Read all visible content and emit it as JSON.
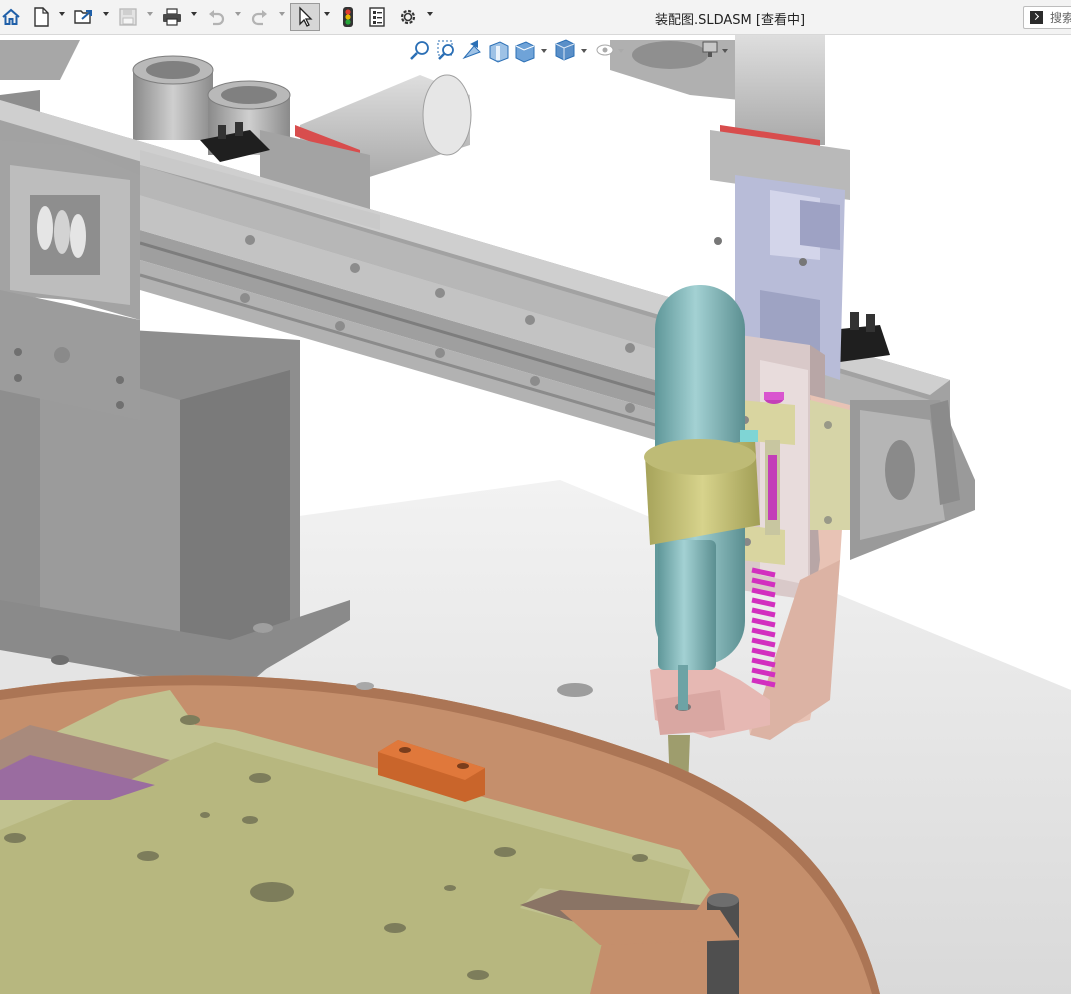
{
  "window": {
    "document_title": "装配图.SLDASM [查看中]",
    "search_placeholder": "搜索"
  },
  "toolbar": {
    "buttons": [
      {
        "name": "home-icon"
      },
      {
        "name": "new-document-icon"
      },
      {
        "name": "open-icon"
      },
      {
        "name": "save-icon"
      },
      {
        "name": "print-icon"
      },
      {
        "name": "undo-icon"
      },
      {
        "name": "redo-icon"
      },
      {
        "name": "select-pointer-icon"
      },
      {
        "name": "rebuild-traffic-light-icon"
      },
      {
        "name": "file-properties-icon"
      },
      {
        "name": "options-gear-icon"
      }
    ]
  },
  "heads_up_toolbar": {
    "buttons": [
      {
        "name": "zoom-to-fit-icon"
      },
      {
        "name": "zoom-to-area-icon"
      },
      {
        "name": "previous-view-icon"
      },
      {
        "name": "section-view-icon"
      },
      {
        "name": "view-orientation-icon"
      },
      {
        "name": "display-style-icon"
      },
      {
        "name": "hide-show-items-icon"
      },
      {
        "name": "view-settings-icon"
      }
    ]
  },
  "colors": {
    "toolbar_bg": "#f3f3f3",
    "frame_gray": "#a6a6a6",
    "rail_gray": "#b4b4b4",
    "turntable_copper": "#c58f6c",
    "fixture_plate": "#c1c290",
    "cylinder_teal": "#7fb3b5",
    "clamp_yellow": "#c6c27a",
    "bracket_pink": "#e2b3ae",
    "spring_magenta": "#d22fbf",
    "floor_gray": "#e3e3e3"
  }
}
